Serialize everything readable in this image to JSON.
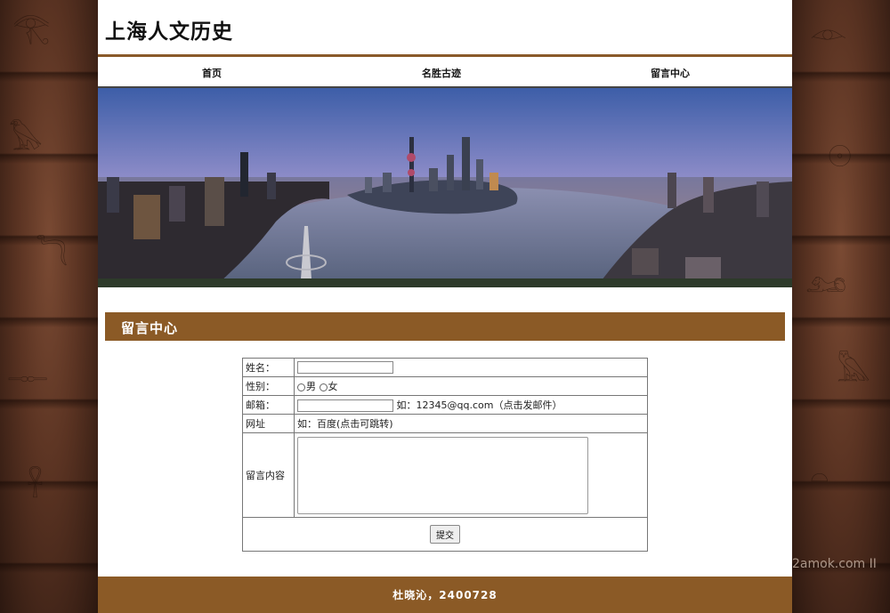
{
  "site": {
    "title": "上海人文历史"
  },
  "nav": {
    "items": [
      {
        "label": "首页"
      },
      {
        "label": "名胜古迹"
      },
      {
        "label": "留言中心"
      }
    ]
  },
  "section": {
    "title": "留言中心"
  },
  "form": {
    "name_label": "姓名：",
    "name_value": "",
    "gender_label": "性别：",
    "gender_options": [
      "男",
      "女"
    ],
    "email_label": "邮箱：",
    "email_value": "",
    "email_hint": "如：12345@qq.com（点击发邮件）",
    "url_label": "网址",
    "url_hint": "如：百度(点击可跳转)",
    "message_label": "留言内容",
    "message_value": "",
    "submit_label": "提交"
  },
  "footer": {
    "text": "杜晓沁，2400728"
  },
  "watermark": {
    "text": "2amok.com  II"
  },
  "colors": {
    "accent": "#8b5a26",
    "nav_border": "#8a5a2a"
  }
}
